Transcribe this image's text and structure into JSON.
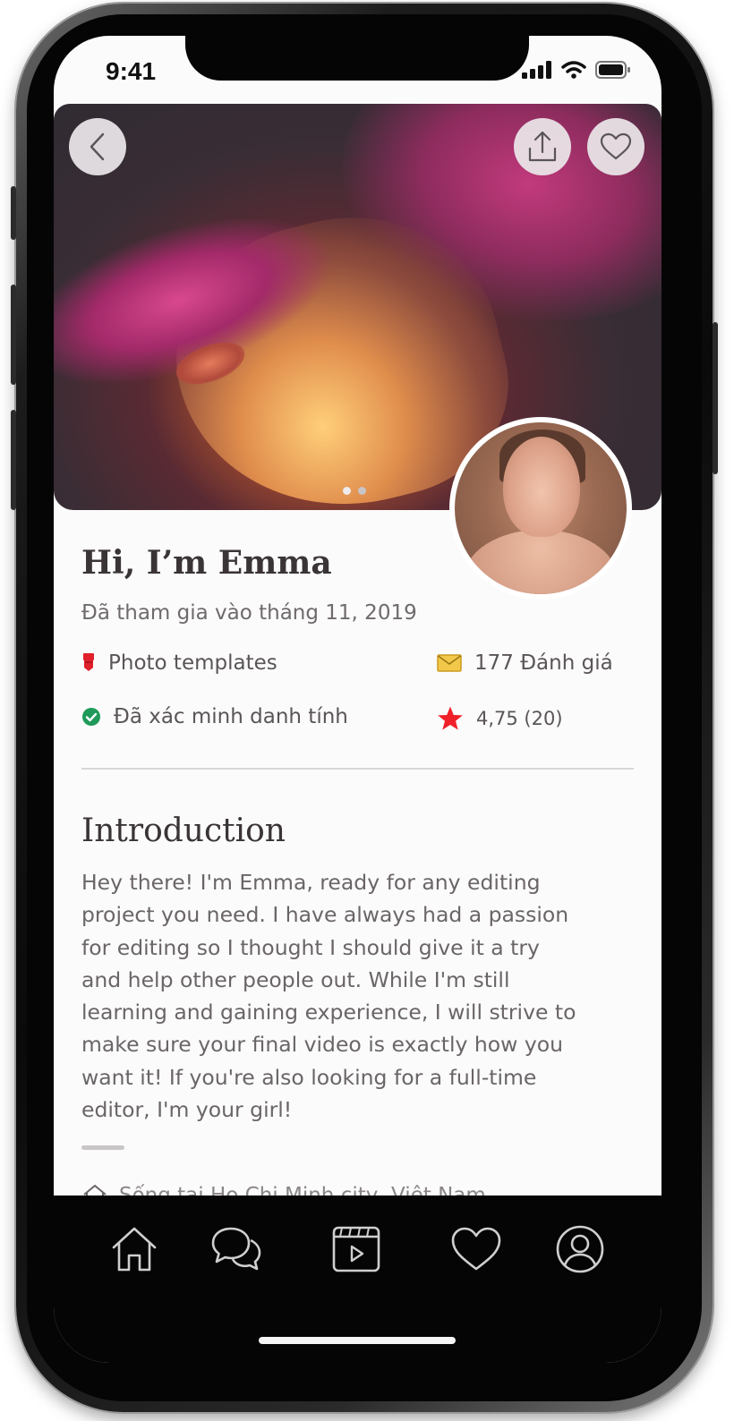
{
  "status_bar": {
    "time": "9:41"
  },
  "profile": {
    "greeting": "Hi, I’m Emma",
    "joined": "Đã tham gia vào tháng 11, 2019",
    "category": "Photo templates",
    "reviews": "177 Đánh giá",
    "verified": "Đã xác minh danh tính",
    "rating": "4,75 (20)"
  },
  "introduction": {
    "title": "Introduction",
    "lines": [
      "Hey there!  I'm Emma, ready for any editing",
      "project you need. I have always had a passion",
      "for editing so I thought I should give it a try",
      "and help other people out. While I'm still",
      "learning and gaining experience, I will strive to",
      "make sure your final video is exactly how you",
      "want it!   If you're also looking for a full-time",
      "editor, I'm your girl!"
    ]
  },
  "location": "Sống tại Ho Chi Minh city, Việt Nam",
  "hero": {
    "slide_count": 2,
    "active_slide": 1
  },
  "tabbar": {
    "items": [
      "home-icon",
      "chat-icon",
      "video-icon",
      "heart-icon",
      "profile-icon"
    ]
  },
  "colors": {
    "badge_red": "#e0202a",
    "verified_green": "#1f9a5a",
    "star_red": "#f0202a",
    "envelope_yellow": "#f2c84b"
  }
}
